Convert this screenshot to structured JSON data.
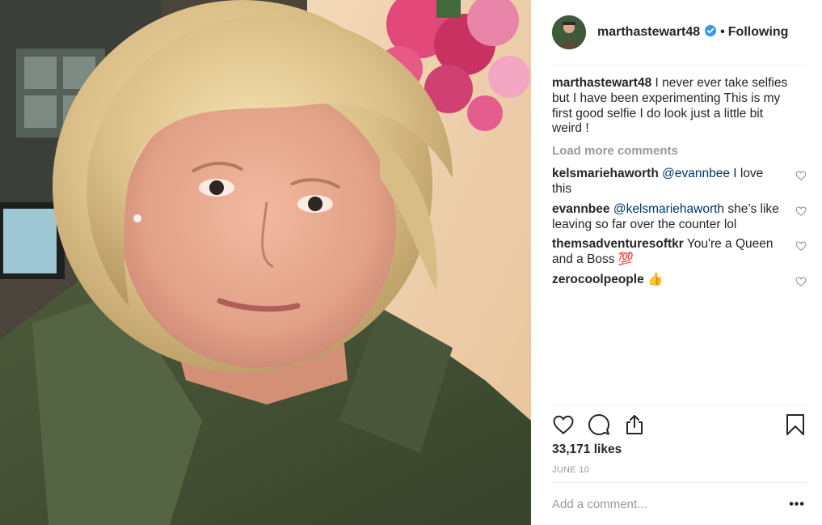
{
  "header": {
    "username": "marthastewart48",
    "separator": "•",
    "follow_status": "Following"
  },
  "caption": {
    "username": "marthastewart48",
    "text": "I never ever take selfies but I have been experimenting This is my first good selfie I do look just a little bit weird !"
  },
  "load_more": "Load more comments",
  "comments": [
    {
      "username": "kelsmariehaworth",
      "mention": "@evannbee",
      "text": " I love this"
    },
    {
      "username": "evannbee",
      "mention": "@kelsmariehaworth",
      "text": " she’s like leaving so far over the counter lol"
    },
    {
      "username": "themsadventuresoftkr",
      "mention": "",
      "text": "You're a Queen and a Boss 💯"
    },
    {
      "username": "zerocoolpeople",
      "mention": "",
      "text": "👍"
    }
  ],
  "likes": "33,171 likes",
  "date": "JUNE 10",
  "comment_box": {
    "placeholder": "Add a comment...",
    "more": "•••"
  },
  "icons": {
    "like": "heart-icon",
    "comment": "comment-bubble-icon",
    "share": "share-icon",
    "save": "bookmark-icon",
    "verified": "verified-badge-icon"
  },
  "colors": {
    "verified": "#3897f0",
    "mention": "#003569",
    "muted": "#999999",
    "text": "#262626",
    "divider": "#efefef"
  }
}
